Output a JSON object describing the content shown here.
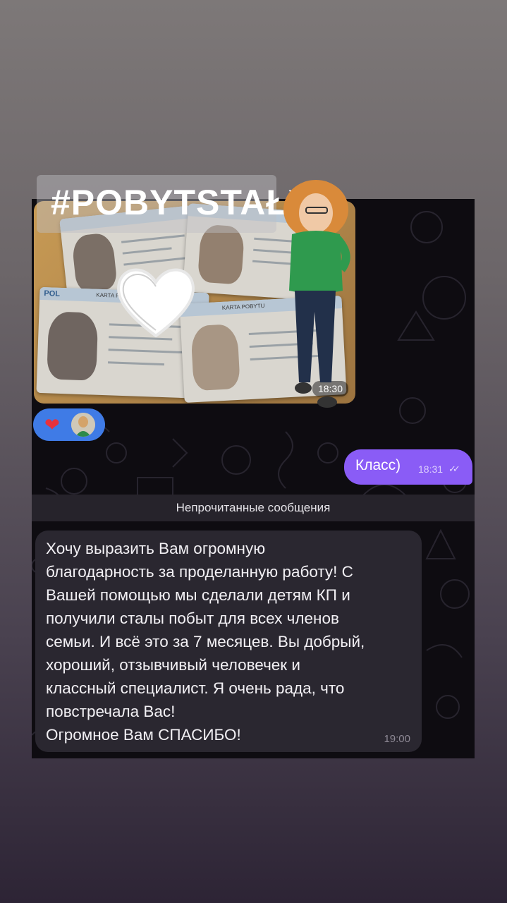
{
  "story": {
    "hashtag": "#POBYTSTAŁY"
  },
  "chat": {
    "photo_message": {
      "time": "18:30",
      "card_label": "POL",
      "card_title": "KARTA POBYTU"
    },
    "reactions": {
      "emoji": "❤"
    },
    "outgoing_message": {
      "text": "Класс)",
      "time": "18:31",
      "status_icon": "double-check-icon"
    },
    "unread_divider": "Непрочитанные сообщения",
    "incoming_message": {
      "text": "Хочу выразить Вам огромную\nблагодарность за проделанную работу! С\nВашей помощью мы сделали детям КП и\nполучили сталы побыт для всех членов\nсемьи. И всё это за 7 месяцев. Вы добрый,\nхороший, отзывчивый человечек и\nклассный специалист. Я очень рада, что\nповстречала Вас!\nОгромное Вам СПАСИБО!",
      "time": "19:00"
    }
  },
  "colors": {
    "outgoing_bubble": "#8a5cf6",
    "incoming_bubble": "#2a2730",
    "reaction_pill": "#3f7be6",
    "chat_background": "#0e0c11"
  }
}
